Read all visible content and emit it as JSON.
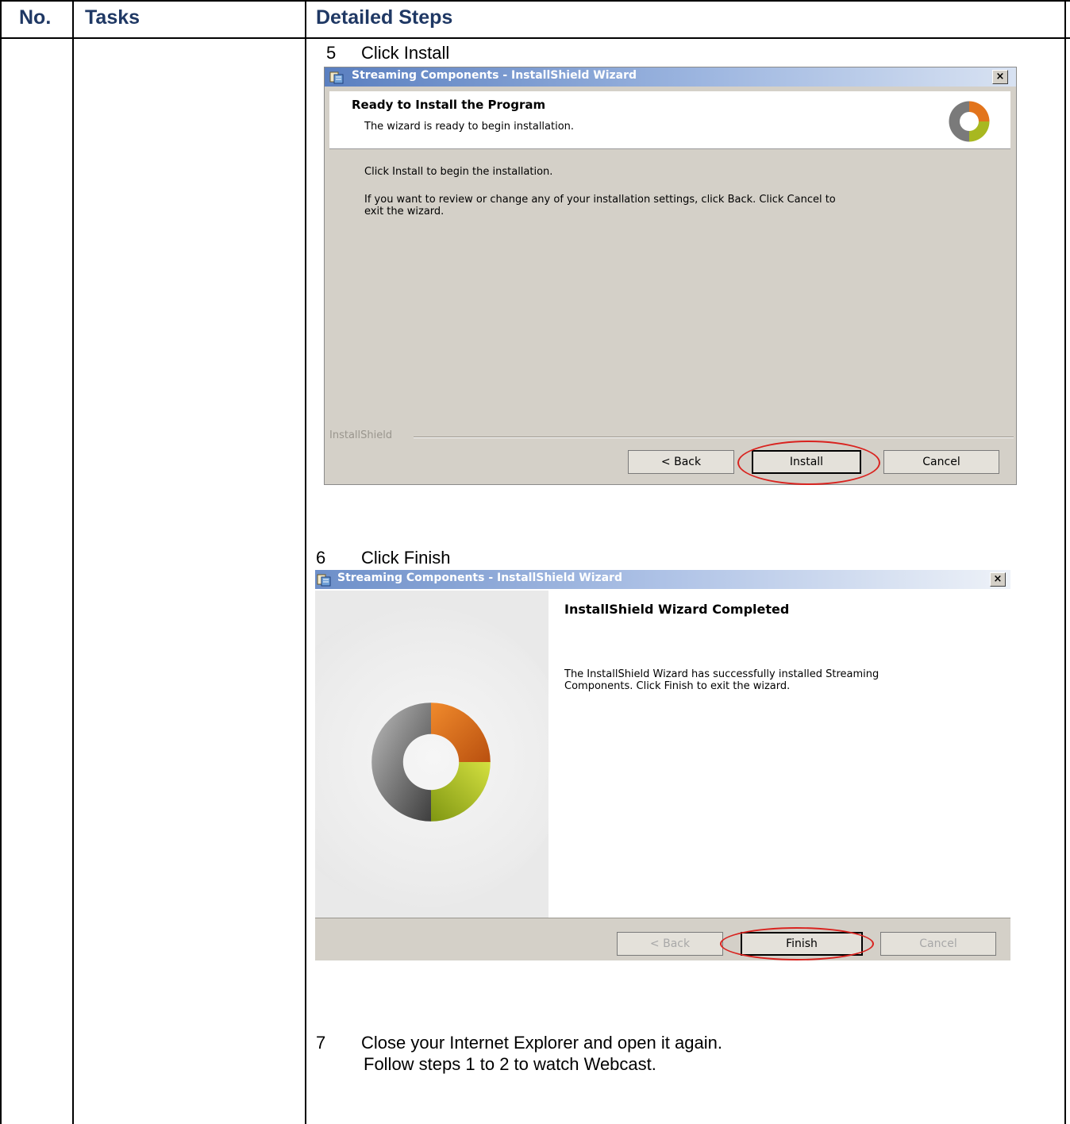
{
  "table": {
    "headers": {
      "no": "No.",
      "tasks": "Tasks",
      "steps": "Detailed Steps"
    }
  },
  "steps": [
    {
      "num": "5",
      "text": "Click Install"
    },
    {
      "num": "6",
      "text": "Click Finish"
    },
    {
      "num": "7",
      "text": "Close your Internet Explorer and open it again.",
      "text2": "Follow steps 1 to 2 to watch Webcast."
    }
  ],
  "dialog_install": {
    "title": "Streaming Components - InstallShield Wizard",
    "close_label": "×",
    "heading": "Ready to Install the Program",
    "subheading": "The wizard is ready to begin installation.",
    "body1": "Click Install to begin the installation.",
    "body2_line1": "If you want to review or change any of your installation settings, click Back. Click Cancel to",
    "body2_line2": "exit the wizard.",
    "footer_brand": "InstallShield",
    "buttons": {
      "back": "< Back",
      "install": "Install",
      "cancel": "Cancel"
    }
  },
  "dialog_finish": {
    "title": "Streaming Components - InstallShield Wizard",
    "close_label": "×",
    "heading": "InstallShield Wizard Completed",
    "body_line1": "The InstallShield Wizard has successfully installed Streaming",
    "body_line2": "Components. Click Finish to exit the wizard.",
    "buttons": {
      "back": "< Back",
      "finish": "Finish",
      "cancel": "Cancel"
    }
  },
  "colors": {
    "header_text": "#1f3864",
    "dialog_bg": "#d4d0c8",
    "highlight_oval": "#d9231f",
    "logo_orange": "#e2741c",
    "logo_green": "#a8b820",
    "logo_gray": "#7a7a7a"
  }
}
